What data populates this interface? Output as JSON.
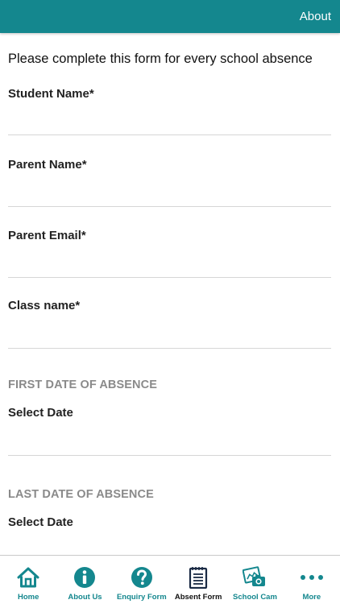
{
  "header": {
    "about_label": "About"
  },
  "form": {
    "intro": "Please complete this form for every school absence",
    "fields": [
      {
        "label": "Student Name*",
        "value": ""
      },
      {
        "label": "Parent Name*",
        "value": ""
      },
      {
        "label": "Parent Email*",
        "value": ""
      },
      {
        "label": "Class name*",
        "value": ""
      }
    ],
    "first_absence": {
      "title": "FIRST DATE OF ABSENCE",
      "date_label": "Select Date",
      "value": ""
    },
    "last_absence": {
      "title": "LAST DATE OF ABSENCE",
      "date_label": "Select Date",
      "value": ""
    }
  },
  "tabbar": {
    "tabs": [
      {
        "label": "Home",
        "icon": "home-icon"
      },
      {
        "label": "About Us",
        "icon": "info-icon"
      },
      {
        "label": "Enquiry Form",
        "icon": "question-icon"
      },
      {
        "label": "Absent Form",
        "icon": "notepad-icon",
        "active": true
      },
      {
        "label": "School Cam",
        "icon": "camera-photo-icon"
      },
      {
        "label": "More",
        "icon": "more-dots-icon"
      }
    ]
  },
  "colors": {
    "accent": "#14878e",
    "section_title": "#8a8a8a",
    "divider": "#d6d6d6"
  }
}
